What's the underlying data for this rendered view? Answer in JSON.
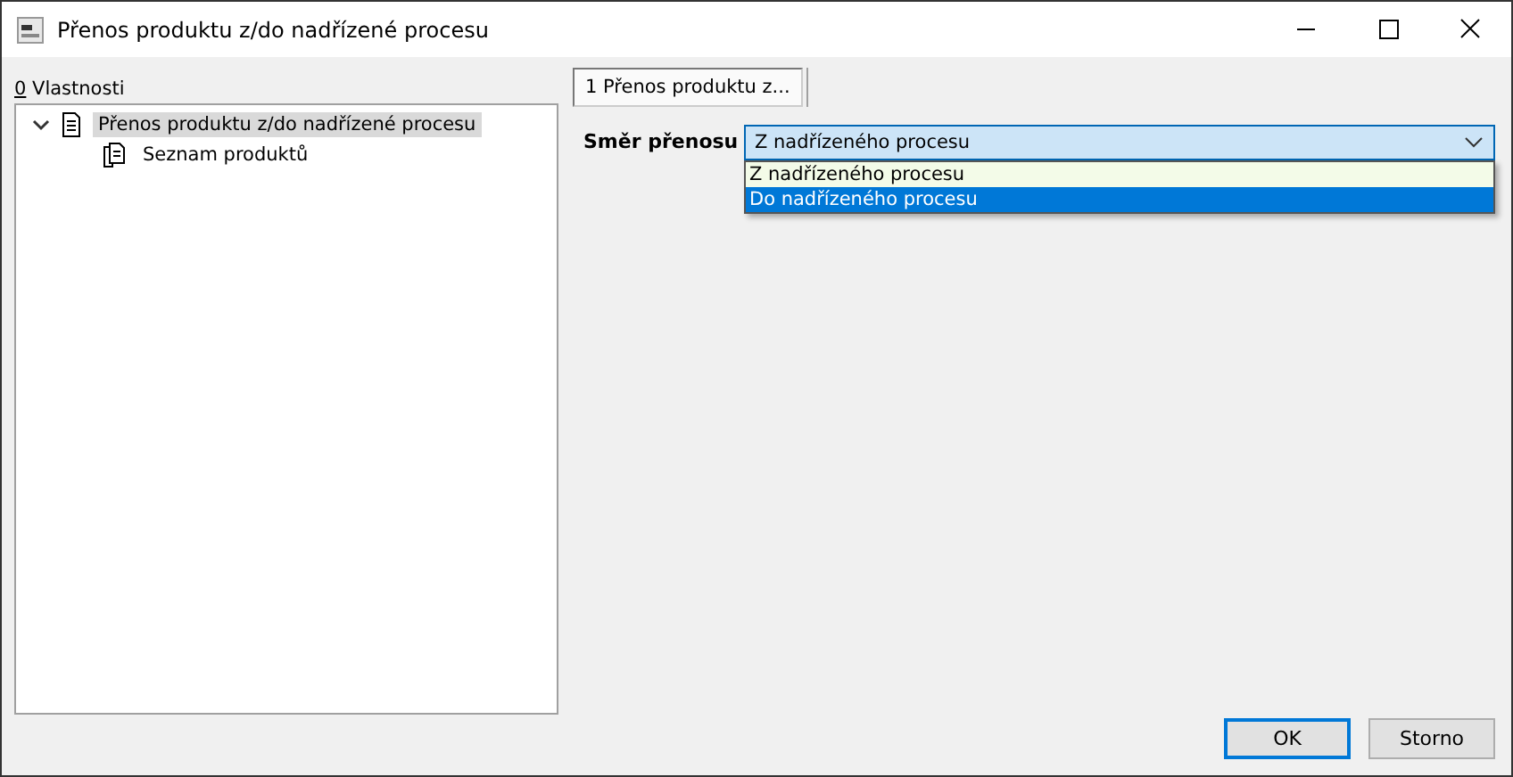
{
  "window": {
    "title": "Přenos produktu z/do nadřízené procesu"
  },
  "left_panel": {
    "label": "0 Vlastnosti",
    "tree": [
      {
        "label": "Přenos produktu z/do nadřízené procesu",
        "expanded": true,
        "selected": true,
        "children": [
          {
            "label": "Seznam produktů",
            "selected": false
          }
        ]
      }
    ]
  },
  "tabs": [
    {
      "label": "1 Přenos produktu z...",
      "selected": true
    }
  ],
  "field": {
    "label": "Směr přenosu",
    "value": "Z nadřízeného procesu",
    "open": true,
    "options": [
      {
        "label": "Z nadřízeného procesu",
        "selected": true,
        "highlighted": false
      },
      {
        "label": "Do nadřízeného procesu",
        "selected": false,
        "highlighted": true
      }
    ]
  },
  "buttons": [
    {
      "label": "OK",
      "default": true
    },
    {
      "label": "Storno",
      "default": false
    }
  ]
}
